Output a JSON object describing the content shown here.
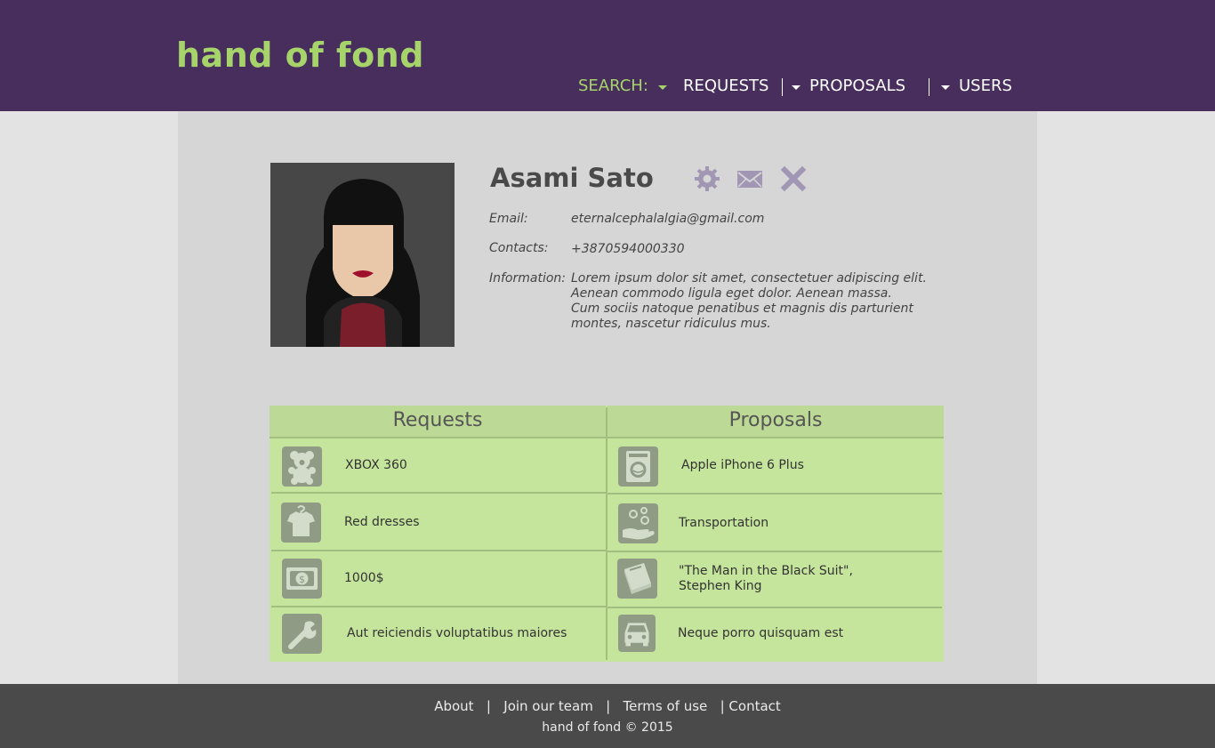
{
  "header": {
    "logo": "hand of fond",
    "nav": {
      "search_label": "SEARCH:",
      "requests_label": "REQUESTS",
      "proposals_label": "PROPOSALS",
      "users_label": "USERS"
    }
  },
  "profile": {
    "name": "Asami Sato",
    "email_label": "Email:",
    "email": "eternalcephalalgia@gmail.com",
    "contacts_label": "Contacts:",
    "contacts": "+3870594000330",
    "information_label": "Information:",
    "information_lines": [
      "Lorem ipsum dolor sit amet, consectetuer adipiscing elit.",
      "Aenean commodo ligula eget dolor. Aenean massa.",
      "Cum sociis natoque penatibus et magnis dis parturient",
      "montes, nascetur ridiculus mus."
    ],
    "actions": {
      "settings_icon": "gear-icon",
      "message_icon": "envelope-icon",
      "remove_icon": "close-icon"
    }
  },
  "tables": {
    "requests_title": "Requests",
    "proposals_title": "Proposals",
    "requests": [
      {
        "icon": "teddy-bear-icon",
        "text": "XBOX 360"
      },
      {
        "icon": "tshirt-icon",
        "text": "Red dresses"
      },
      {
        "icon": "money-icon",
        "text": "1000$"
      },
      {
        "icon": "wrench-icon",
        "text": "Aut reiciendis voluptatibus maiores"
      }
    ],
    "proposals": [
      {
        "icon": "washing-machine-icon",
        "text": "Apple iPhone 6 Plus"
      },
      {
        "icon": "hand-bubbles-icon",
        "text": "Transportation"
      },
      {
        "icon": "book-icon",
        "text_lines": [
          "\"The Man in the Black Suit\",",
          "Stephen King"
        ]
      },
      {
        "icon": "car-icon",
        "text": "Neque porro quisquam est"
      }
    ]
  },
  "footer": {
    "links": [
      "About",
      "Join our team",
      "Terms of use",
      "Contact"
    ],
    "copyright": "hand of fond © 2015"
  },
  "colors": {
    "header_bg": "#472e5c",
    "accent_green": "#a6d46b",
    "table_bg": "#c5e49c",
    "icon_bg": "#8f9b85",
    "action_icon": "#a196b4",
    "footer_bg": "#4a4a4a"
  }
}
